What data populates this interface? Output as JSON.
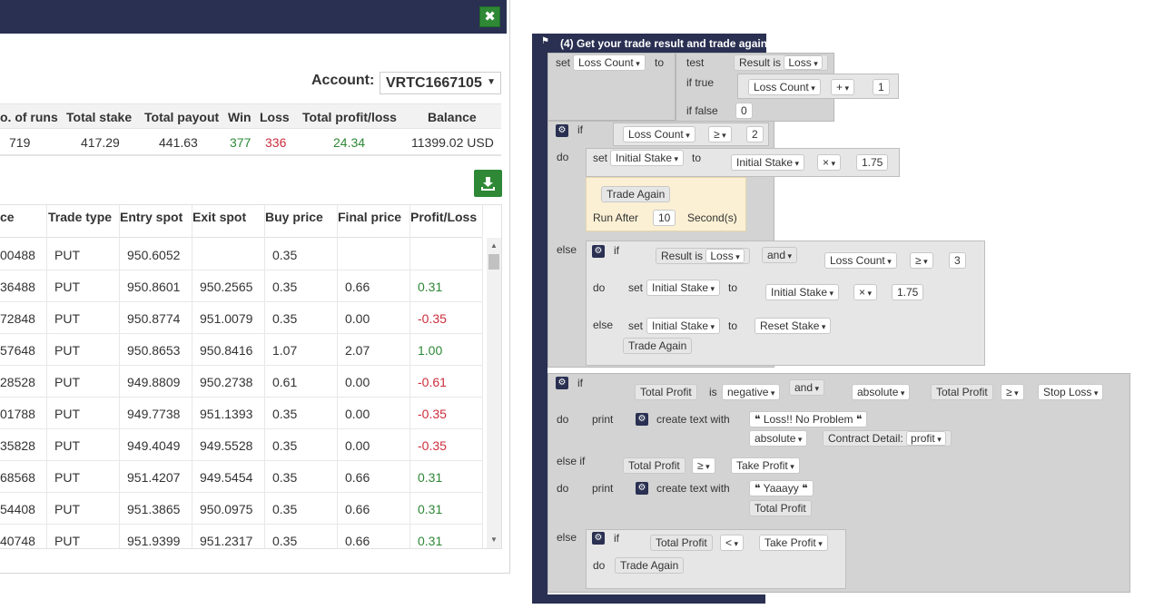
{
  "dialog": {
    "close_icon": "close-icon",
    "account_label": "Account:",
    "account_value": "VRTC1667105",
    "summary_headers": [
      "o. of runs",
      "Total stake",
      "Total payout",
      "Win",
      "Loss",
      "Total profit/loss",
      "Balance"
    ],
    "summary_values": {
      "runs": "719",
      "stake": "417.29",
      "payout": "441.63",
      "win": "377",
      "loss": "336",
      "profit": "24.34",
      "balance": "11399.02 USD"
    },
    "download_icon": "download-icon",
    "trade_headers": [
      "ce",
      "Trade type",
      "Entry spot",
      "Exit spot",
      "Buy price",
      "Final price",
      "Profit/Loss"
    ],
    "trades": [
      {
        "ref": "00488",
        "type": "PUT",
        "entry": "950.6052",
        "exit": "",
        "buy": "0.35",
        "final": "",
        "pl": ""
      },
      {
        "ref": "36488",
        "type": "PUT",
        "entry": "950.8601",
        "exit": "950.2565",
        "buy": "0.35",
        "final": "0.66",
        "pl": "0.31"
      },
      {
        "ref": "72848",
        "type": "PUT",
        "entry": "950.8774",
        "exit": "951.0079",
        "buy": "0.35",
        "final": "0.00",
        "pl": "-0.35"
      },
      {
        "ref": "57648",
        "type": "PUT",
        "entry": "950.8653",
        "exit": "950.8416",
        "buy": "1.07",
        "final": "2.07",
        "pl": "1.00"
      },
      {
        "ref": "28528",
        "type": "PUT",
        "entry": "949.8809",
        "exit": "950.2738",
        "buy": "0.61",
        "final": "0.00",
        "pl": "-0.61"
      },
      {
        "ref": "01788",
        "type": "PUT",
        "entry": "949.7738",
        "exit": "951.1393",
        "buy": "0.35",
        "final": "0.00",
        "pl": "-0.35"
      },
      {
        "ref": "35828",
        "type": "PUT",
        "entry": "949.4049",
        "exit": "949.5528",
        "buy": "0.35",
        "final": "0.00",
        "pl": "-0.35"
      },
      {
        "ref": "68568",
        "type": "PUT",
        "entry": "951.4207",
        "exit": "949.5454",
        "buy": "0.35",
        "final": "0.66",
        "pl": "0.31"
      },
      {
        "ref": "54408",
        "type": "PUT",
        "entry": "951.3865",
        "exit": "950.0975",
        "buy": "0.35",
        "final": "0.66",
        "pl": "0.31"
      },
      {
        "ref": "40748",
        "type": "PUT",
        "entry": "951.9399",
        "exit": "951.2317",
        "buy": "0.35",
        "final": "0.66",
        "pl": "0.31"
      }
    ]
  },
  "blocks": {
    "title": "(4) Get your trade result and trade again",
    "set": "set",
    "to": "to",
    "test": "test",
    "if_true": "if true",
    "if_false": "if false",
    "if": "if",
    "do": "do",
    "else": "else",
    "else_if": "else if",
    "print": "print",
    "create_text_with": "create text with",
    "and": "and",
    "is": "is",
    "loss_count": "Loss Count",
    "initial_stake": "Initial Stake",
    "reset_stake": "Reset Stake",
    "result_is": "Result is",
    "loss": "Loss",
    "plus": "+",
    "times": "×",
    "gte": "≥",
    "lt": "<",
    "one": "1",
    "zero": "0",
    "two": "2",
    "three": "3",
    "factor": "1.75",
    "trade_again": "Trade Again",
    "run_after": "Run After",
    "ten": "10",
    "seconds": "Second(s)",
    "total_profit": "Total Profit",
    "negative": "negative",
    "absolute": "absolute",
    "stop_loss": "Stop Loss",
    "take_profit": "Take Profit",
    "quote": "❝",
    "loss_msg": "Loss!! No Problem",
    "contract_detail": "Contract Detail:",
    "profit": "profit",
    "yay_msg": "Yaaayy"
  },
  "colors": {
    "header": "#2a3052",
    "green": "#2e8836",
    "red": "#cc2e3d",
    "block_gray": "#d3d3d3",
    "block_yellow": "#fbf0d4"
  }
}
